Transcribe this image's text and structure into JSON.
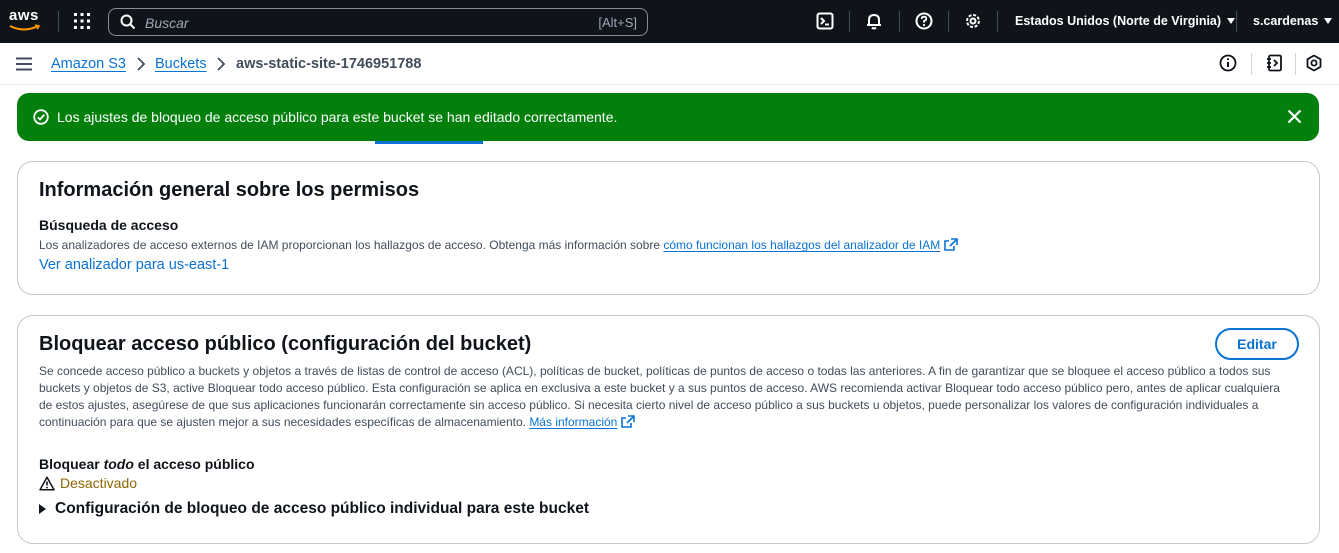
{
  "topnav": {
    "logo_text": "aws",
    "search": {
      "placeholder": "Buscar",
      "shortcut": "[Alt+S]"
    },
    "icons": [
      "cloudshell-icon",
      "bell-icon",
      "help-icon",
      "settings-icon"
    ],
    "region": "Estados Unidos (Norte de Virginia)",
    "user": "s.cardenas"
  },
  "breadcrumb": {
    "items": [
      "Amazon S3",
      "Buckets"
    ],
    "current": "aws-static-site-1746951788"
  },
  "flash": {
    "type": "success",
    "message": "Los ajustes de bloqueo de acceso público para este bucket se han editado correctamente."
  },
  "permissions": {
    "title": "Información general sobre los permisos",
    "access_label": "Búsqueda de acceso",
    "access_desc": "Los analizadores de acceso externos de IAM proporcionan los hallazgos de acceso. Obtenga más información sobre",
    "access_link": "cómo funcionan los hallazgos del analizador de IAM",
    "analyzer_link": "Ver analizador para us-east-1"
  },
  "block_public": {
    "title": "Bloquear acceso público (configuración del bucket)",
    "edit_label": "Editar",
    "desc_lines": [
      "Se concede acceso público a buckets y objetos a través de listas de control de acceso (ACL), políticas de bucket, políticas de puntos de acceso o todas las anteriores. A fin de garantizar que se bloquee el acceso público a todos sus",
      "buckets y objetos de S3, active Bloquear todo acceso público. Esta configuración se aplica en exclusiva a este bucket y a sus puntos de acceso. AWS recomienda activar Bloquear todo acceso público pero, antes de aplicar cualquiera",
      "de estos ajustes, asegúrese de que sus aplicaciones funcionarán correctamente sin acceso público. Si necesita cierto nivel de acceso público a sus buckets u objetos, puede personalizar los valores de configuración individuales a",
      "continuación para que se ajusten mejor a sus necesidades específicas de almacenamiento."
    ],
    "more_info": "Más información",
    "block_all_prefix": "Bloquear ",
    "block_all_em": "todo",
    "block_all_suffix": " el acceso público",
    "status": "Desactivado",
    "expander": "Configuración de bloqueo de acceso público individual para este bucket"
  },
  "colors": {
    "nav_bg": "#0f141a",
    "link": "#0972d3",
    "success": "#037f0c",
    "warning": "#8d6605"
  }
}
